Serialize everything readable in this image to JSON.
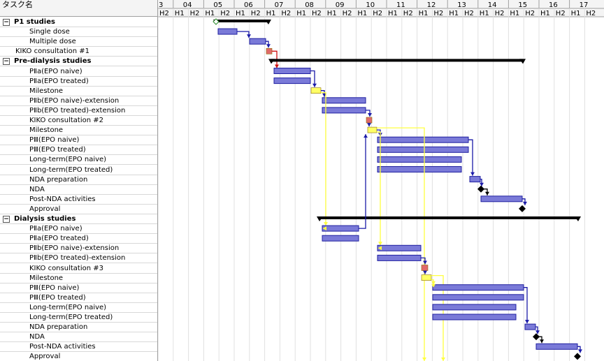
{
  "task_column_header": "タスク名",
  "timescale": {
    "years": [
      "3",
      "04",
      "05",
      "06",
      "07",
      "08",
      "09",
      "10",
      "11",
      "12",
      "13",
      "14",
      "15",
      "16",
      "17"
    ],
    "halves": [
      "H2",
      "H1",
      "H2",
      "H1",
      "H2",
      "H1",
      "H2",
      "H1",
      "H2",
      "H1",
      "H2",
      "H1",
      "H2",
      "H1",
      "H2",
      "H1",
      "H2",
      "H1",
      "H2",
      "H1",
      "H2",
      "H1",
      "H2",
      "H1",
      "H2",
      "H1",
      "H2",
      "H1",
      "H2"
    ]
  },
  "tasks": [
    {
      "name": "P1 studies",
      "group": true,
      "indent": 0,
      "toggle": "−"
    },
    {
      "name": "Single dose",
      "group": false,
      "indent": 2
    },
    {
      "name": "Multiple dose",
      "group": false,
      "indent": 2
    },
    {
      "name": "KIKO consultation #1",
      "group": false,
      "indent": 1
    },
    {
      "name": "Pre-dialysis studies",
      "group": true,
      "indent": 0,
      "toggle": "−"
    },
    {
      "name": "PⅡa(EPO naive)",
      "group": false,
      "indent": 2
    },
    {
      "name": "PⅡa(EPO treated)",
      "group": false,
      "indent": 2
    },
    {
      "name": "Milestone",
      "group": false,
      "indent": 2
    },
    {
      "name": "PⅡb(EPO naive)-extension",
      "group": false,
      "indent": 2
    },
    {
      "name": "PⅡb(EPO treated)-extension",
      "group": false,
      "indent": 2
    },
    {
      "name": "KIKO consultation #2",
      "group": false,
      "indent": 2
    },
    {
      "name": "Milestone",
      "group": false,
      "indent": 2
    },
    {
      "name": "PⅢ(EPO naive)",
      "group": false,
      "indent": 2
    },
    {
      "name": "PⅢ(EPO treated)",
      "group": false,
      "indent": 2
    },
    {
      "name": "Long-term(EPO naive)",
      "group": false,
      "indent": 2
    },
    {
      "name": "Long-term(EPO treated)",
      "group": false,
      "indent": 2
    },
    {
      "name": "NDA preparation",
      "group": false,
      "indent": 2
    },
    {
      "name": "NDA",
      "group": false,
      "indent": 2
    },
    {
      "name": "Post-NDA activities",
      "group": false,
      "indent": 2
    },
    {
      "name": "Approval",
      "group": false,
      "indent": 2
    },
    {
      "name": "Dialysis studies",
      "group": true,
      "indent": 0,
      "toggle": "−"
    },
    {
      "name": "PⅡa(EPO naive)",
      "group": false,
      "indent": 2
    },
    {
      "name": "PⅡa(EPO treated)",
      "group": false,
      "indent": 2
    },
    {
      "name": "PⅡb(EPO naive)-extension",
      "group": false,
      "indent": 2
    },
    {
      "name": "PⅡb(EPO treated)-extension",
      "group": false,
      "indent": 2
    },
    {
      "name": "KIKO consultation #3",
      "group": false,
      "indent": 2
    },
    {
      "name": "Milestone",
      "group": false,
      "indent": 2
    },
    {
      "name": "PⅢ(EPO naive)",
      "group": false,
      "indent": 2
    },
    {
      "name": "PⅢ(EPO treated)",
      "group": false,
      "indent": 2
    },
    {
      "name": "Long-term(EPO naive)",
      "group": false,
      "indent": 2
    },
    {
      "name": "Long-term(EPO treated)",
      "group": false,
      "indent": 2
    },
    {
      "name": "NDA preparation",
      "group": false,
      "indent": 2
    },
    {
      "name": "NDA",
      "group": false,
      "indent": 2
    },
    {
      "name": "Post-NDA activities",
      "group": false,
      "indent": 2
    },
    {
      "name": "Approval",
      "group": false,
      "indent": 2
    }
  ],
  "colors": {
    "task_bar": "#7a7ad8",
    "task_bar_border": "#2020a0",
    "summary_bar": "#000000",
    "consultation_box": "#e06a6a",
    "milestone_box": "#ffff66",
    "link_blue": "#1a1aa8",
    "link_yellow": "#ffff40",
    "link_red": "#d01010",
    "grid": "#e0e0e0"
  }
}
